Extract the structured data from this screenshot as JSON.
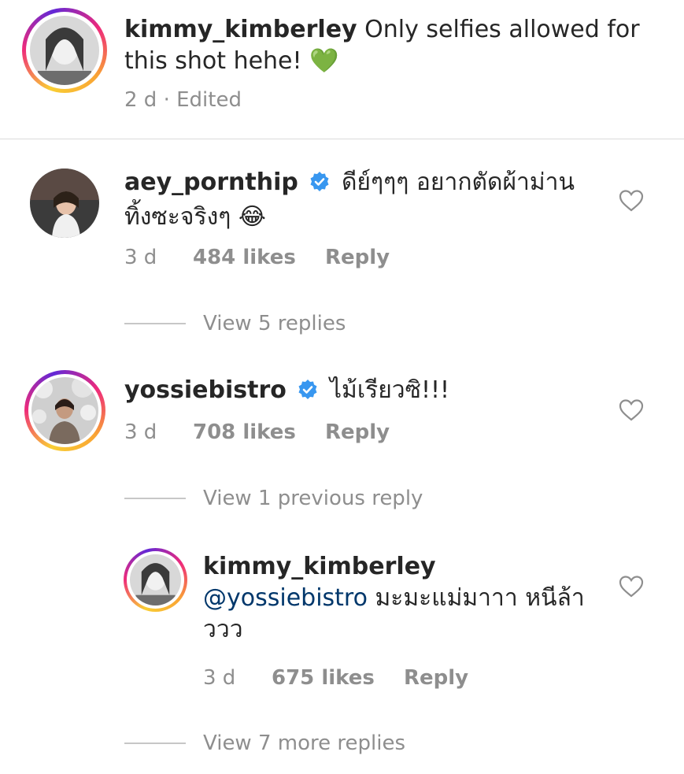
{
  "caption": {
    "username": "kimmy_kimberley",
    "text": "Only selfies allowed for this shot hehe!",
    "emoji": "💚",
    "time": "2 d",
    "edited": "· Edited"
  },
  "comments": [
    {
      "username": "aey_pornthip",
      "verified": true,
      "text_line1": "ดีย์ๆๆๆ อยากตัดผ้าม่าน",
      "text_line2": "ทิ้งซะจริงๆ",
      "emoji": "😂",
      "time": "3 d",
      "likes": "484 likes",
      "reply": "Reply",
      "view_replies": "View 5 replies"
    },
    {
      "username": "yossiebistro",
      "verified": true,
      "text_line1": "ไม้เรียวซิ!!!",
      "time": "3 d",
      "likes": "708 likes",
      "reply": "Reply",
      "view_replies": "View 1 previous reply",
      "reply_item": {
        "username": "kimmy_kimberley",
        "mention": "@yossiebistro",
        "text_line1": "มะมะแม่มาาา หนีล้า",
        "text_line2": "ววว",
        "time": "3 d",
        "likes": "675 likes",
        "reply": "Reply"
      },
      "more_replies": "View 7 more replies"
    }
  ],
  "colors": {
    "text": "#262626",
    "muted": "#8e8e8e",
    "mention": "#00376b",
    "verified": "#3897f0",
    "heart_emoji": "#4caf50"
  },
  "icons": [
    "heart-outline-icon",
    "verified-badge-icon"
  ]
}
